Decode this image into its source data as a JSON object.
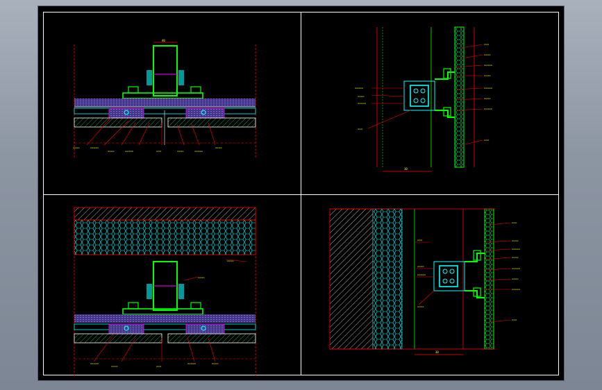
{
  "drawing": {
    "background": "#000000",
    "frame_color": "#ffffff",
    "colors": {
      "profile": "#00ff00",
      "dimension": "#ff0000",
      "insulation": "#00ffff",
      "anchor": "#ff00ff",
      "bolt": "#00ffff",
      "text": "#ffff00",
      "hatch": "#ffffff"
    }
  },
  "views": [
    {
      "id": "top-left",
      "name": "horizontal-section-a"
    },
    {
      "id": "top-right",
      "name": "vertical-section-a"
    },
    {
      "id": "bottom-left",
      "name": "horizontal-section-b"
    },
    {
      "id": "bottom-right",
      "name": "vertical-section-b"
    }
  ]
}
